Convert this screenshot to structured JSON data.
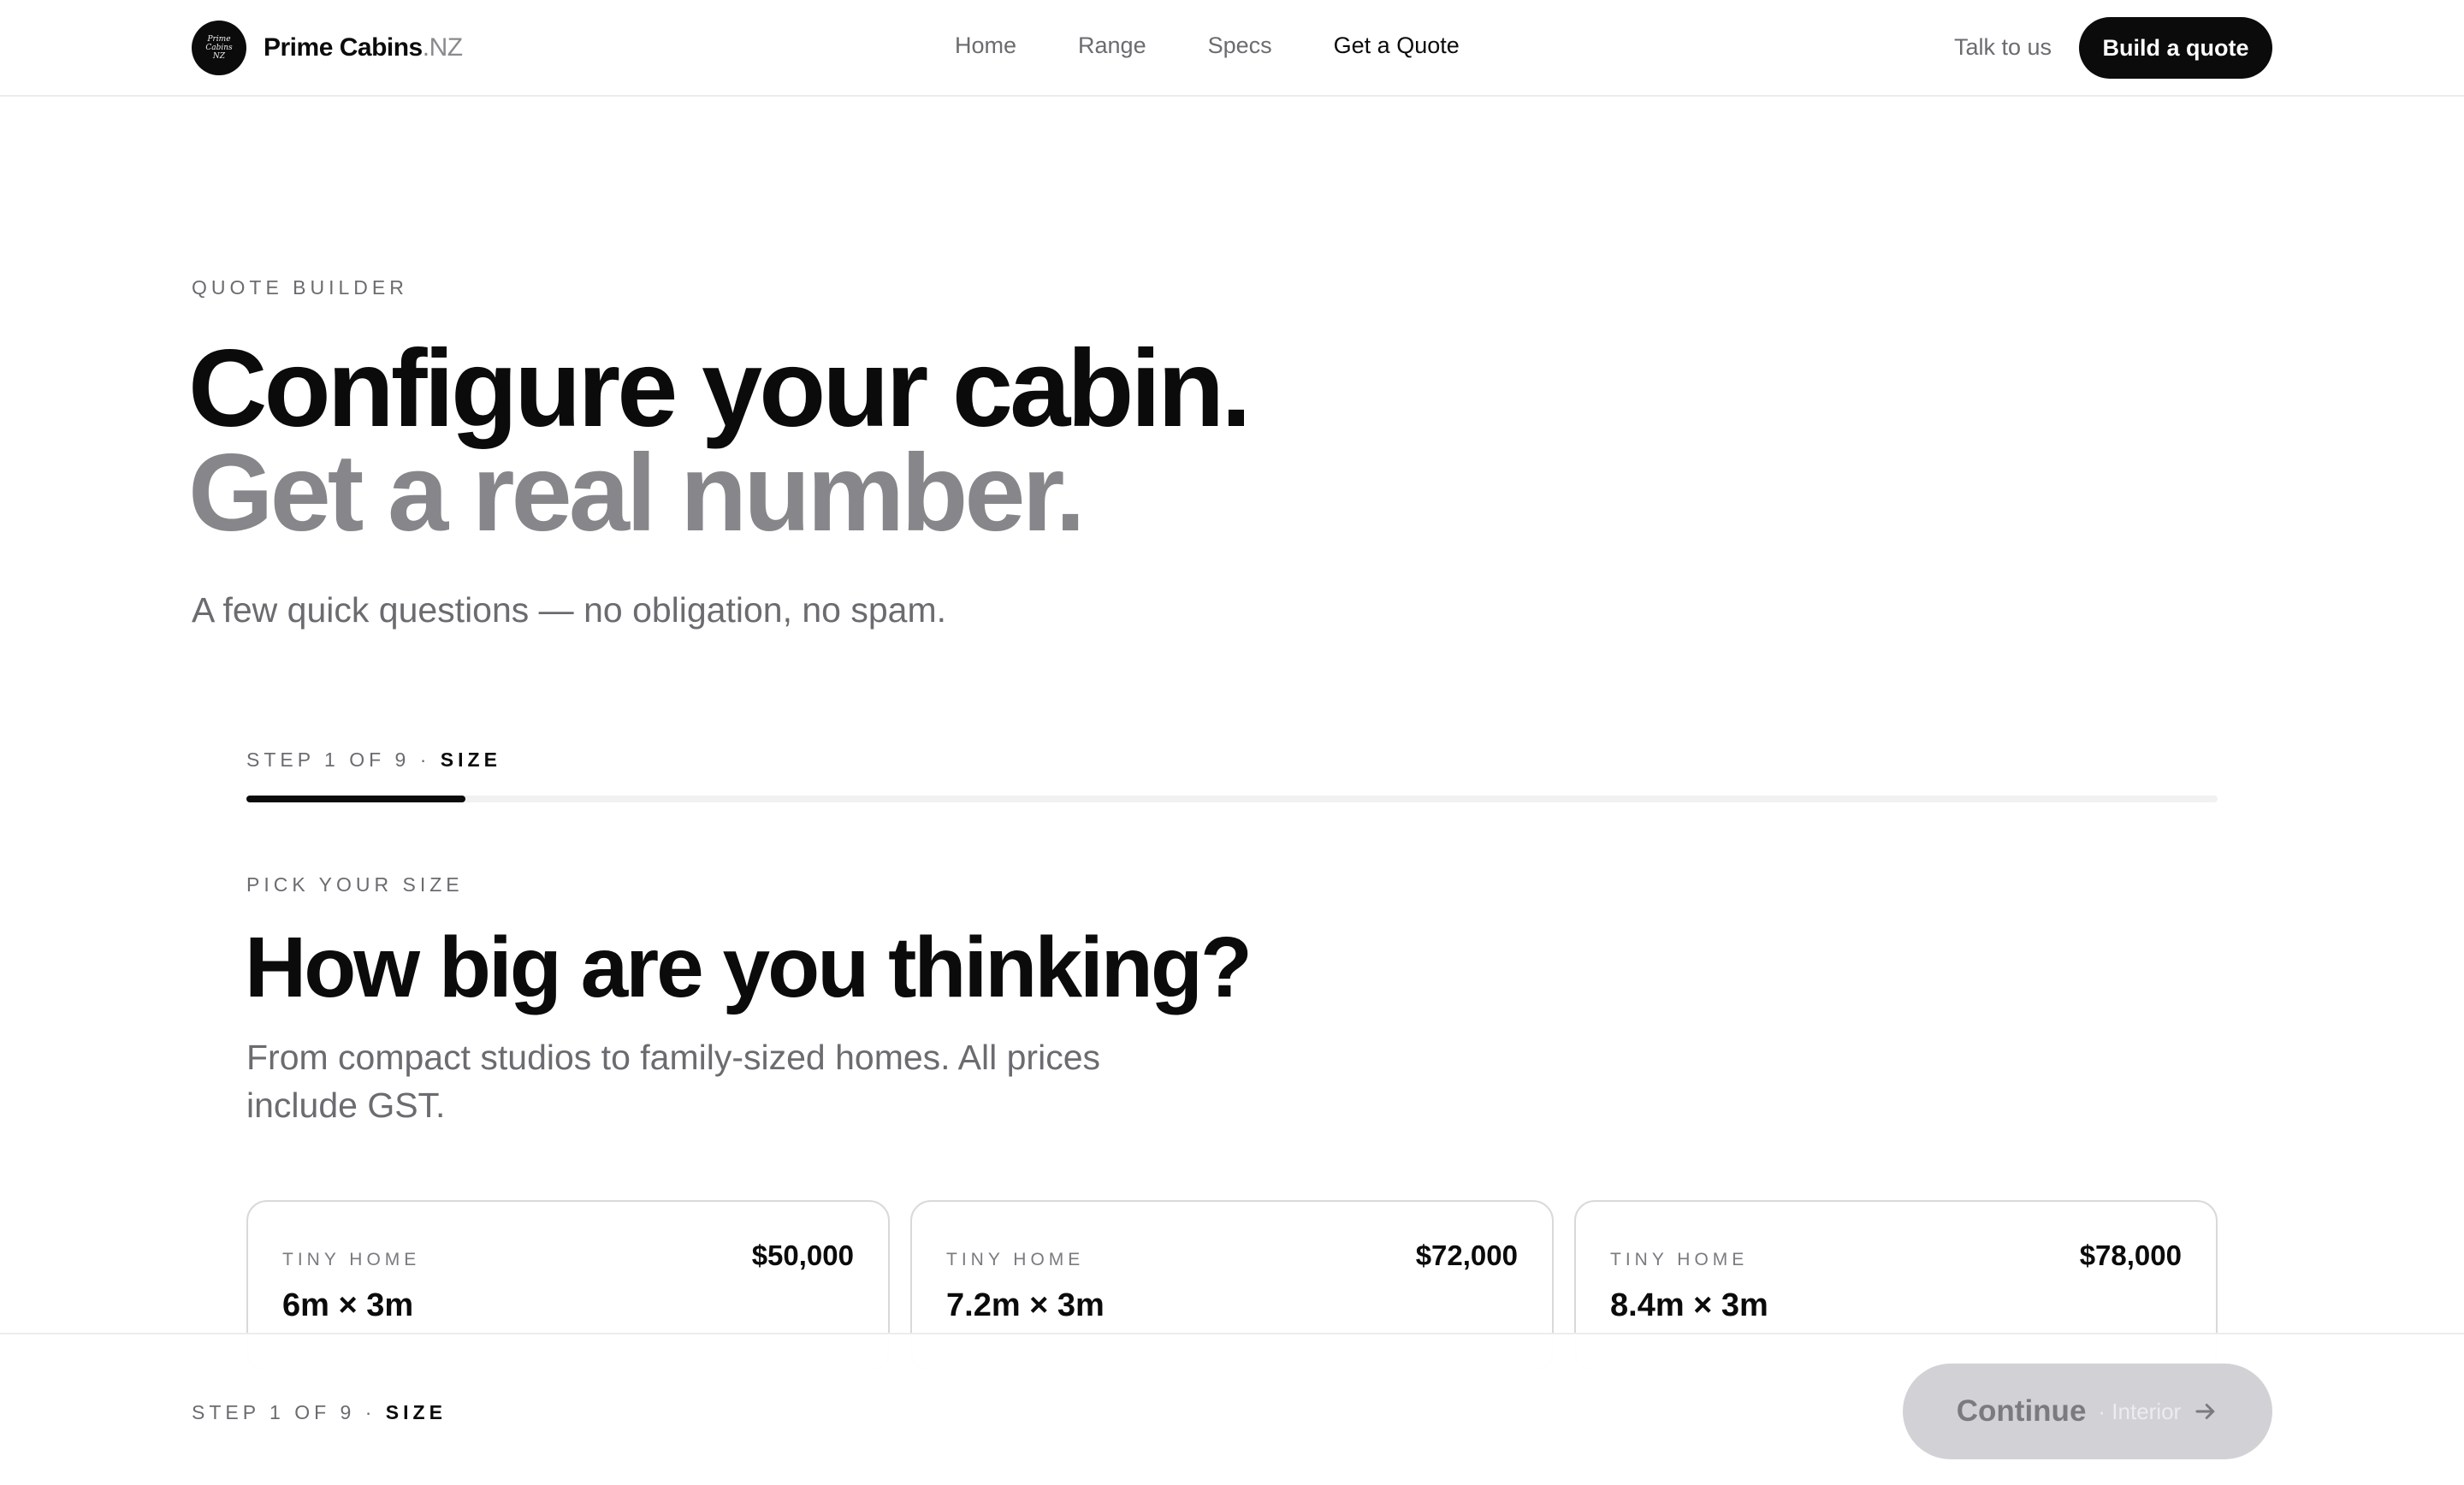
{
  "nav": {
    "brand": "Prime Cabins",
    "brand_suffix": ".NZ",
    "logo_text": [
      "Prime",
      "Cabins",
      "NZ"
    ],
    "links": [
      "Home",
      "Range",
      "Specs",
      "Get a Quote"
    ],
    "active_link": "Get a Quote",
    "talk": "Talk to us",
    "cta": "Build a quote"
  },
  "hero": {
    "eyebrow": "QUOTE BUILDER",
    "title_line1": "Configure your cabin.",
    "title_line2": "Get a real number.",
    "lead": "A few quick questions — no obligation, no spam."
  },
  "progress": {
    "step_text": "STEP 1 OF 9 · ",
    "step_name": "SIZE",
    "current": 1,
    "total": 9
  },
  "question": {
    "eyebrow": "PICK YOUR SIZE",
    "title": "How big are you thinking?",
    "subtitle": "From compact studios to family-sized homes. All prices include GST."
  },
  "cards": [
    {
      "tag": "TINY HOME",
      "price": "$50,000",
      "dim": "6m × 3m"
    },
    {
      "tag": "TINY HOME",
      "price": "$72,000",
      "dim": "7.2m × 3m"
    },
    {
      "tag": "TINY HOME",
      "price": "$78,000",
      "dim": "8.4m × 3m"
    }
  ],
  "footer": {
    "step_text": "STEP 1 OF 9 · ",
    "step_name": "SIZE",
    "continue_label": "Continue",
    "continue_sub": "· Interior",
    "continue_icon": "arrow-right-icon"
  },
  "colors": {
    "accent": "#0b0b0c",
    "muted": "#86868b",
    "disabled_button": "#d2d2d6"
  }
}
